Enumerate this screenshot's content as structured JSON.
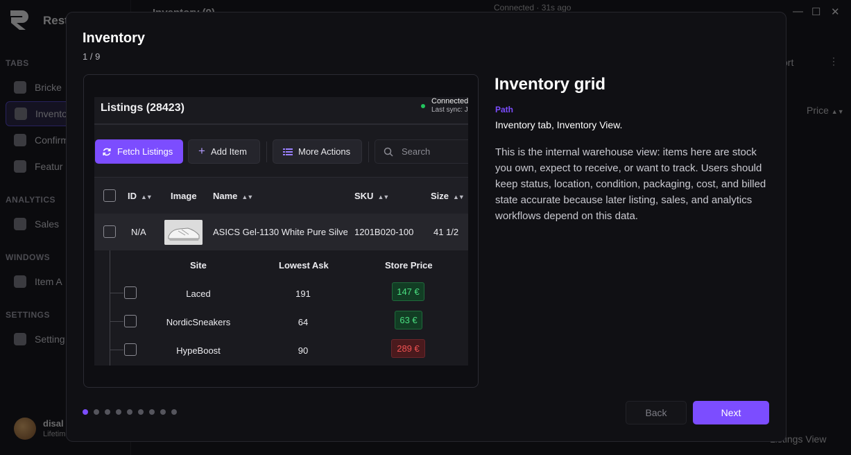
{
  "background": {
    "app_name": "Rest",
    "topbar_title": "Inventory (9)",
    "connection": "Connected · 31s ago",
    "sections": {
      "tabs": "TABS",
      "analytics": "ANALYTICS",
      "windows": "WINDOWS",
      "settings": "SETTINGS"
    },
    "nav": {
      "bricked": "Bricke",
      "inventory": "Invento",
      "confirm": "Confirm",
      "features": "Featur",
      "sales": "Sales",
      "item": "Item A",
      "settings": "Setting"
    },
    "user_name": "disal",
    "user_sub": "Lifetim",
    "right_export": "ort",
    "right_price": "Price",
    "listings_view": "Listings View"
  },
  "modal": {
    "title": "Inventory",
    "step": "1 / 9",
    "screenshot": {
      "title": "Listings (28423)",
      "connected": "Connected",
      "last_sync": "Last sync: J",
      "fetch_label": "Fetch Listings",
      "add_label": "Add Item",
      "more_label": "More Actions",
      "search_placeholder": "Search",
      "columns": {
        "id": "ID",
        "image": "Image",
        "name": "Name",
        "sku": "SKU",
        "size": "Size"
      },
      "row": {
        "id": "N/A",
        "name": "ASICS Gel-1130 White Pure Silve",
        "sku": "1201B020-100",
        "size": "41 1/2"
      },
      "sub_columns": {
        "site": "Site",
        "lowest_ask": "Lowest Ask",
        "store_price": "Store Price"
      },
      "sub_rows": [
        {
          "site": "Laced",
          "lowest_ask": "191",
          "store_price": "147 €",
          "status": "green"
        },
        {
          "site": "NordicSneakers",
          "lowest_ask": "64",
          "store_price": "63 €",
          "status": "green"
        },
        {
          "site": "HypeBoost",
          "lowest_ask": "90",
          "store_price": "289 €",
          "status": "red"
        }
      ]
    },
    "info": {
      "heading": "Inventory grid",
      "path_label": "Path",
      "path_value": "Inventory tab, Inventory View.",
      "description": "This is the internal warehouse view: items here are stock you own, expect to receive, or want to track. Users should keep status, location, condition, packaging, cost, and billed state accurate because later listing, sales, and analytics workflows depend on this data."
    },
    "pagination": {
      "current": 1,
      "total": 9
    },
    "back_label": "Back",
    "next_label": "Next"
  },
  "colors": {
    "accent": "#7c4dff",
    "price_green": "#4ade80",
    "price_red": "#f05252",
    "connected_dot": "#22c55e"
  }
}
